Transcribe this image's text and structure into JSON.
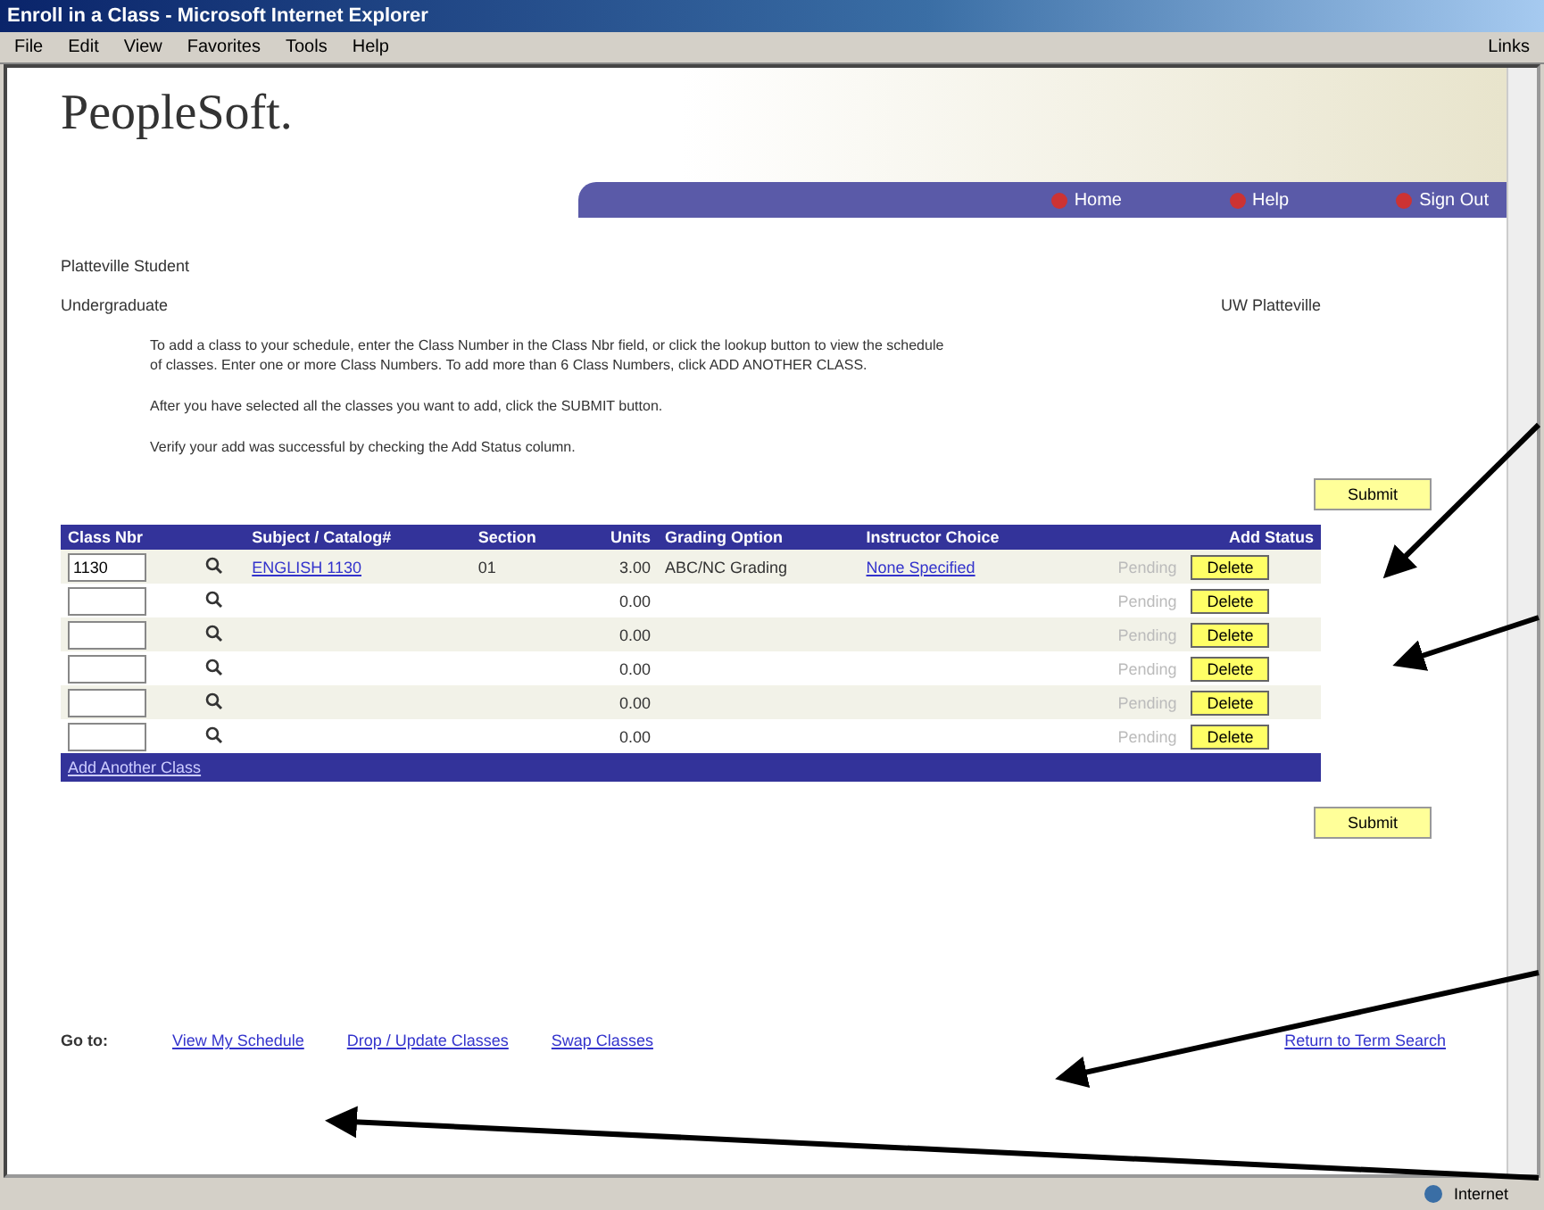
{
  "window": {
    "title": "Enroll in a Class - Microsoft Internet Explorer"
  },
  "menu": [
    "File",
    "Edit",
    "View",
    "Favorites",
    "Tools",
    "Help"
  ],
  "links_label": "Links",
  "header": {
    "logo": "PeopleSoft.",
    "nav": [
      "Home",
      "Help",
      "Sign Out"
    ]
  },
  "student": {
    "name": "Platteville Student",
    "career": "Undergraduate",
    "institution": "UW Platteville"
  },
  "instructions": [
    "To add a class to your schedule, enter the Class Number in the Class Nbr field, or click the lookup button to view the schedule of classes. Enter one or more Class Numbers. To add more than 6 Class Numbers, click ADD ANOTHER CLASS.",
    "After you have selected all the classes you want to add, click the SUBMIT button.",
    "Verify your add was successful by checking the Add Status column."
  ],
  "submit_labels": [
    "Submit",
    "Submit"
  ],
  "table": {
    "columns": [
      "Class Nbr",
      "Subject / Catalog#",
      "Section",
      "Units",
      "Grading Option",
      "Instructor Choice",
      "Add Status"
    ],
    "rows": [
      {
        "class_nbr": "1130",
        "subject": "ENGLISH 1130",
        "section": "01",
        "units": "3.00",
        "grading": "ABC/NC Grading",
        "instructor": "None Specified",
        "status": "Pending",
        "action": "Delete"
      },
      {
        "class_nbr": "",
        "subject": "",
        "section": "",
        "units": "0.00",
        "grading": "",
        "instructor": "",
        "status": "Pending",
        "action": "Delete"
      },
      {
        "class_nbr": "",
        "subject": "",
        "section": "",
        "units": "0.00",
        "grading": "",
        "instructor": "",
        "status": "Pending",
        "action": "Delete"
      },
      {
        "class_nbr": "",
        "subject": "",
        "section": "",
        "units": "0.00",
        "grading": "",
        "instructor": "",
        "status": "Pending",
        "action": "Delete"
      },
      {
        "class_nbr": "",
        "subject": "",
        "section": "",
        "units": "0.00",
        "grading": "",
        "instructor": "",
        "status": "Pending",
        "action": "Delete"
      },
      {
        "class_nbr": "",
        "subject": "",
        "section": "",
        "units": "0.00",
        "grading": "",
        "instructor": "",
        "status": "Pending",
        "action": "Delete"
      }
    ],
    "footer_link": "Add Another Class"
  },
  "go_to": {
    "label": "Go to:",
    "links": [
      "View My Schedule",
      "Drop / Update Classes",
      "Swap Classes"
    ],
    "return_link": "Return to Term Search"
  },
  "status_bar": {
    "zone": "Internet"
  }
}
